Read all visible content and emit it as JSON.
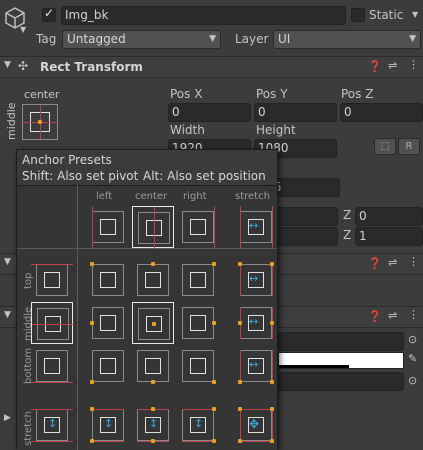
{
  "header": {
    "name": "Img_bk",
    "static_label": "Static",
    "tag_label": "Tag",
    "tag_value": "Untagged",
    "layer_label": "Layer",
    "layer_value": "UI"
  },
  "rect_transform": {
    "title": "Rect Transform",
    "anchor_h": "center",
    "anchor_v": "middle",
    "pos_x_label": "Pos X",
    "pos_y_label": "Pos Y",
    "pos_z_label": "Pos Z",
    "pos_x": "0",
    "pos_y": "0",
    "pos_z": "0",
    "width_label": "Width",
    "height_label": "Height",
    "width": "1920",
    "height": "1080",
    "r_button": "R",
    "partial_value": "5",
    "rot_z_label": "Z",
    "rot_z": "0",
    "scale_z_label": "Z",
    "scale_z": "1"
  },
  "anchor_presets": {
    "title": "Anchor Presets",
    "hint_shift": "Shift: Also set pivot",
    "hint_alt": "Alt: Also set position",
    "columns": [
      "left",
      "center",
      "right",
      "stretch"
    ],
    "rows": [
      "top",
      "middle",
      "bottom",
      "stretch"
    ]
  },
  "colors": {
    "accent": "#e8a020",
    "anchor_red": "#c0404a",
    "stretch_blue": "#3aa6e0"
  }
}
